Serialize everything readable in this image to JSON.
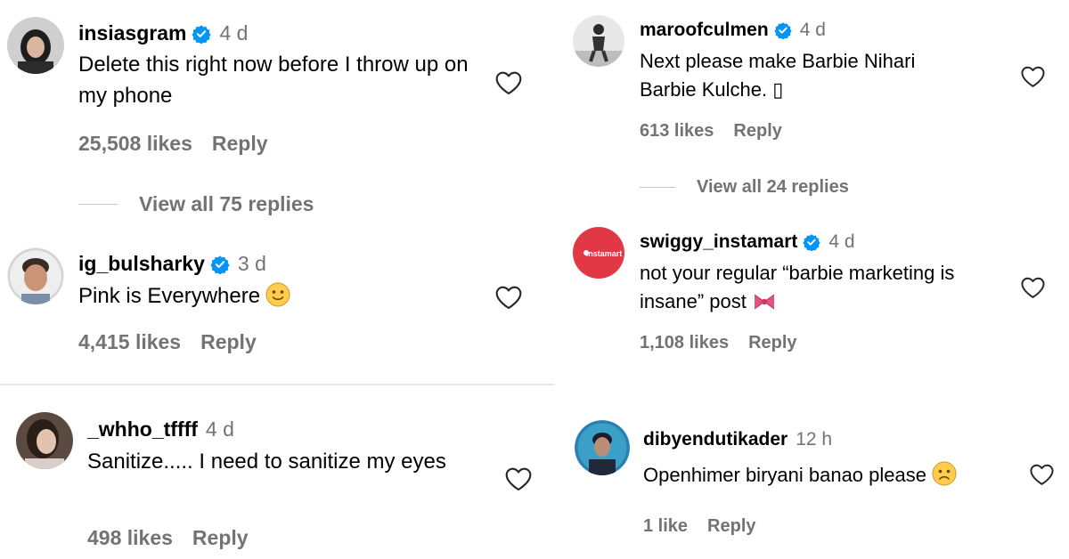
{
  "comments": [
    {
      "username": "insiasgram",
      "verified": true,
      "time": "4 d",
      "text": "Delete this right now before I throw up on my phone",
      "likes": "25,508 likes",
      "reply": "Reply",
      "view_replies": "View all 75 replies"
    },
    {
      "username": "ig_bulsharky",
      "verified": true,
      "time": "3 d",
      "text": "Pink is Everywhere",
      "emoji": "slightly-smiling-face-emoji",
      "likes": "4,415 likes",
      "reply": "Reply"
    },
    {
      "username": "_whho_tffff",
      "verified": false,
      "time": "4 d",
      "text": "Sanitize..... I need to sanitize my eyes",
      "likes": "498 likes",
      "reply": "Reply"
    },
    {
      "username": "maroofculmen",
      "verified": true,
      "time": "4 d",
      "text": "Next please make Barbie Nihari Barbie Kulche. ▯",
      "likes": "613 likes",
      "reply": "Reply",
      "view_replies": "View all 24 replies"
    },
    {
      "username": "swiggy_instamart",
      "verified": true,
      "time": "4 d",
      "text": "not your regular “barbie marketing is insane” post",
      "emoji": "ribbon-emoji",
      "likes": "1,108 likes",
      "reply": "Reply",
      "avatar_text": "instamart"
    },
    {
      "username": "dibyendutikader",
      "verified": false,
      "time": "12 h",
      "text": "Openhimer biryani banao please",
      "emoji": "frowning-face-emoji",
      "likes": "1 like",
      "reply": "Reply"
    }
  ],
  "colors": {
    "verified_badge": "#0095f6",
    "secondary_text": "#737373",
    "instamart_brand": "#e23744"
  },
  "icons": {
    "like": "heart-outline-icon",
    "verified": "verified-badge-icon"
  }
}
